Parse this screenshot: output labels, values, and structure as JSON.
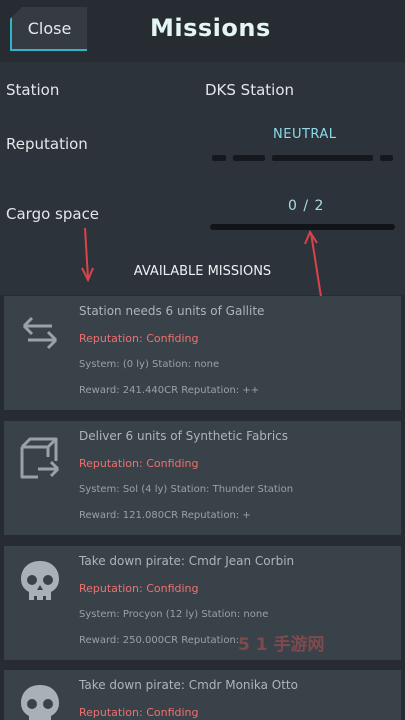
{
  "header": {
    "close_label": "Close",
    "title": "Missions"
  },
  "info": {
    "station_label": "Station",
    "station_value": "DKS Station",
    "reputation_label": "Reputation",
    "reputation_value": "NEUTRAL",
    "cargo_label": "Cargo space",
    "cargo_value": "0 / 2"
  },
  "section_title": "AVAILABLE MISSIONS",
  "missions": [
    {
      "icon": "swap-arrows-icon",
      "title": "Station needs 6 units of Gallite",
      "reputation": "Reputation:  Confiding",
      "system": "System:  (0 ly)    Station: none",
      "reward": "Reward:  241.440CR Reputation: ++"
    },
    {
      "icon": "cargo-delivery-icon",
      "title": "Deliver 6 units of Synthetic Fabrics",
      "reputation": "Reputation:  Confiding",
      "system": "System: Sol (4 ly)    Station: Thunder Station",
      "reward": "Reward:  121.080CR Reputation: +"
    },
    {
      "icon": "skull-icon",
      "title": "Take down pirate: Cmdr Jean Corbin",
      "reputation": "Reputation:  Confiding",
      "system": "System: Procyon (12 ly)    Station: none",
      "reward": "Reward:  250.000CR Reputation:"
    },
    {
      "icon": "skull-icon",
      "title": "Take down pirate: Cmdr Monika Otto",
      "reputation": "Reputation:  Confiding"
    }
  ],
  "watermark": "5 1 手游网",
  "colors": {
    "background": "#272c33",
    "accent": "#2fb4c8",
    "reputation_text": "#f07070",
    "annotation_arrow": "#d9444a"
  }
}
